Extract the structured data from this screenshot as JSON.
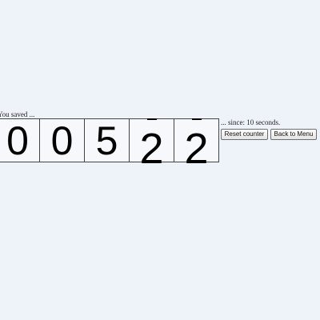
{
  "counter": {
    "prefix_text": "You saved ...",
    "digits": [
      "0",
      "0",
      "5",
      "2",
      "2"
    ],
    "suffix_text": "... since: 10 seconds."
  },
  "buttons": {
    "reset_label": "Reset counter",
    "back_label": "Back to Menu"
  }
}
